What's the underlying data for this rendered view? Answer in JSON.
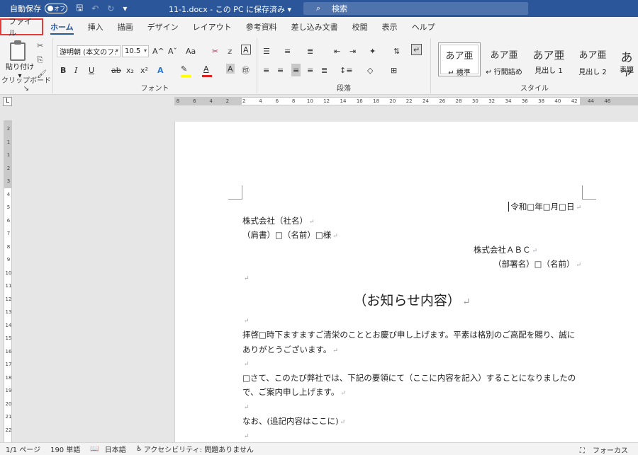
{
  "titlebar": {
    "autosave_label": "自動保存",
    "autosave_state": "オフ",
    "document_title": "11-1.docx - この PC に保存済み",
    "search_placeholder": "検索"
  },
  "tabs": [
    "ファイル",
    "ホーム",
    "挿入",
    "描画",
    "デザイン",
    "レイアウト",
    "参考資料",
    "差し込み文書",
    "校閲",
    "表示",
    "ヘルプ"
  ],
  "active_tab": "ホーム",
  "ribbon": {
    "clipboard": {
      "paste_label": "貼り付け",
      "group_label": "クリップボード"
    },
    "font": {
      "font_name": "游明朝 (本文のフ:",
      "font_size": "10.5",
      "grow": "A^",
      "shrink": "Aˇ",
      "case": "Aa",
      "bold": "B",
      "italic": "I",
      "underline": "U",
      "strike": "ab",
      "subscript": "x₂",
      "superscript": "x²",
      "group_label": "フォント",
      "highlight_color": "#ffff00",
      "font_color": "#e02020"
    },
    "paragraph": {
      "group_label": "段落"
    },
    "styles": {
      "group_label": "スタイル",
      "items": [
        {
          "sample": "あア亜",
          "name": "↵ 標準"
        },
        {
          "sample": "あア亜",
          "name": "↵ 行間詰め"
        },
        {
          "sample": "あア亜",
          "name": "見出し 1"
        },
        {
          "sample": "あア亜",
          "name": "見出し 2"
        },
        {
          "sample": "あア",
          "name": "表題"
        }
      ]
    }
  },
  "ruler": {
    "h_ticks": [
      "8",
      "6",
      "4",
      "2",
      "2",
      "4",
      "6",
      "8",
      "10",
      "12",
      "14",
      "16",
      "18",
      "20",
      "22",
      "24",
      "26",
      "28",
      "30",
      "32",
      "34",
      "36",
      "38",
      "40",
      "42",
      "44",
      "46"
    ],
    "v_ticks": [
      "2",
      "1",
      "1",
      "2",
      "3",
      "4",
      "5",
      "6",
      "7",
      "8",
      "9",
      "10",
      "11",
      "12",
      "13",
      "14",
      "15",
      "16",
      "17",
      "18",
      "19",
      "20",
      "21",
      "22"
    ]
  },
  "document": {
    "date": "令和□年□月□日",
    "recipient_company": "株式会社（社名）",
    "recipient_person": "（肩書）□（名前）□様",
    "sender_company": "株式会社ＡＢＣ",
    "sender_person": "（部署名）□（名前）",
    "heading": "（お知らせ内容）",
    "p1_line1": "拝啓□時下ますますご清栄のこととお慶び申し上げます。平素は格別のご高配を賜り、誠に",
    "p1_line2": "ありがとうございます。",
    "p2_line1": "□さて、このたび弊社では、下記の要領にて（ここに内容を記入）することになりましたの",
    "p2_line2": "で、ご案内申し上げます。",
    "p3_line1": "なお、(追記内容はここに)",
    "para_mark": "↵"
  },
  "status": {
    "page": "1/1 ページ",
    "words": "190 単語",
    "language": "日本語",
    "accessibility": "アクセシビリティ: 問題ありません",
    "focus": "フォーカス"
  }
}
